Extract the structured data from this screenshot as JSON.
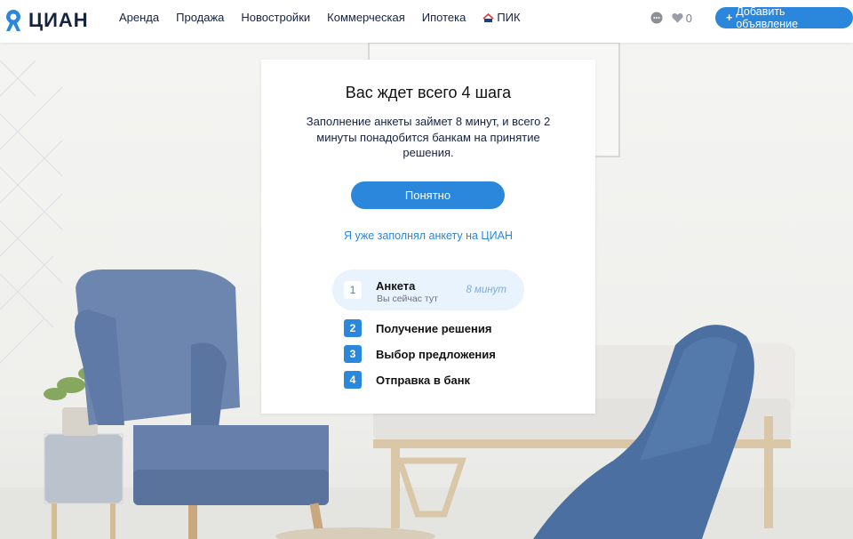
{
  "header": {
    "logo_text": "ЦИАН",
    "logo_icon": "cian-pin-icon",
    "nav": [
      {
        "label": "Аренда"
      },
      {
        "label": "Продажа"
      },
      {
        "label": "Новостройки"
      },
      {
        "label": "Коммерческая"
      },
      {
        "label": "Ипотека"
      },
      {
        "label": "ПИК",
        "icon": "pik-logo-icon"
      }
    ],
    "chat_icon": "chat-icon",
    "favorites_count": "0",
    "add_button_label": "Добавить объявление"
  },
  "modal": {
    "title": "Вас ждет всего 4 шага",
    "description": "Заполнение анкеты займет 8 минут, и всего 2 минуты понадобится банкам на принятие решения.",
    "ok_button": "Понятно",
    "already_filled_link": "Я уже заполнял анкету на ЦИАН",
    "steps": [
      {
        "num": "1",
        "label": "Анкета",
        "sub": "Вы сейчас тут",
        "time": "8 минут",
        "current": true
      },
      {
        "num": "2",
        "label": "Получение решения"
      },
      {
        "num": "3",
        "label": "Выбор предложения"
      },
      {
        "num": "4",
        "label": "Отправка в банк"
      }
    ]
  },
  "colors": {
    "brand_blue": "#2b87db",
    "text_dark": "#152242",
    "active_step_bg": "#e8f3fd"
  }
}
